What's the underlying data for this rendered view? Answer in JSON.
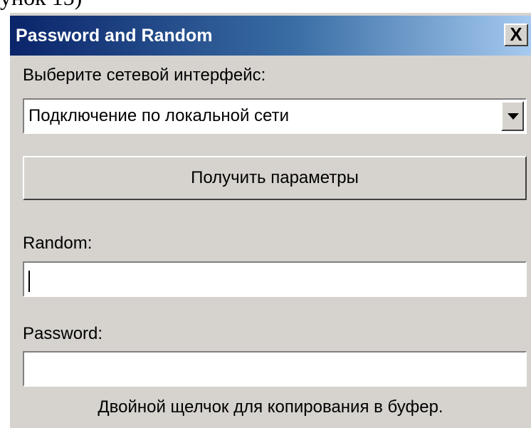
{
  "page_fragment": "унок 15)",
  "window": {
    "title": "Password and Random",
    "close_label": "X"
  },
  "interface": {
    "label": "Выберите сетевой интерфейс:",
    "selected": "Подключение по локальной сети"
  },
  "get_params_button": "Получить параметры",
  "random": {
    "label": "Random:",
    "value": ""
  },
  "password": {
    "label": "Password:",
    "value": ""
  },
  "hint": "Двойной щелчок для копирования в буфер.",
  "colors": {
    "dialog_bg": "#d6d3ce",
    "titlebar_start": "#0a246a",
    "titlebar_end": "#a6caf0"
  }
}
